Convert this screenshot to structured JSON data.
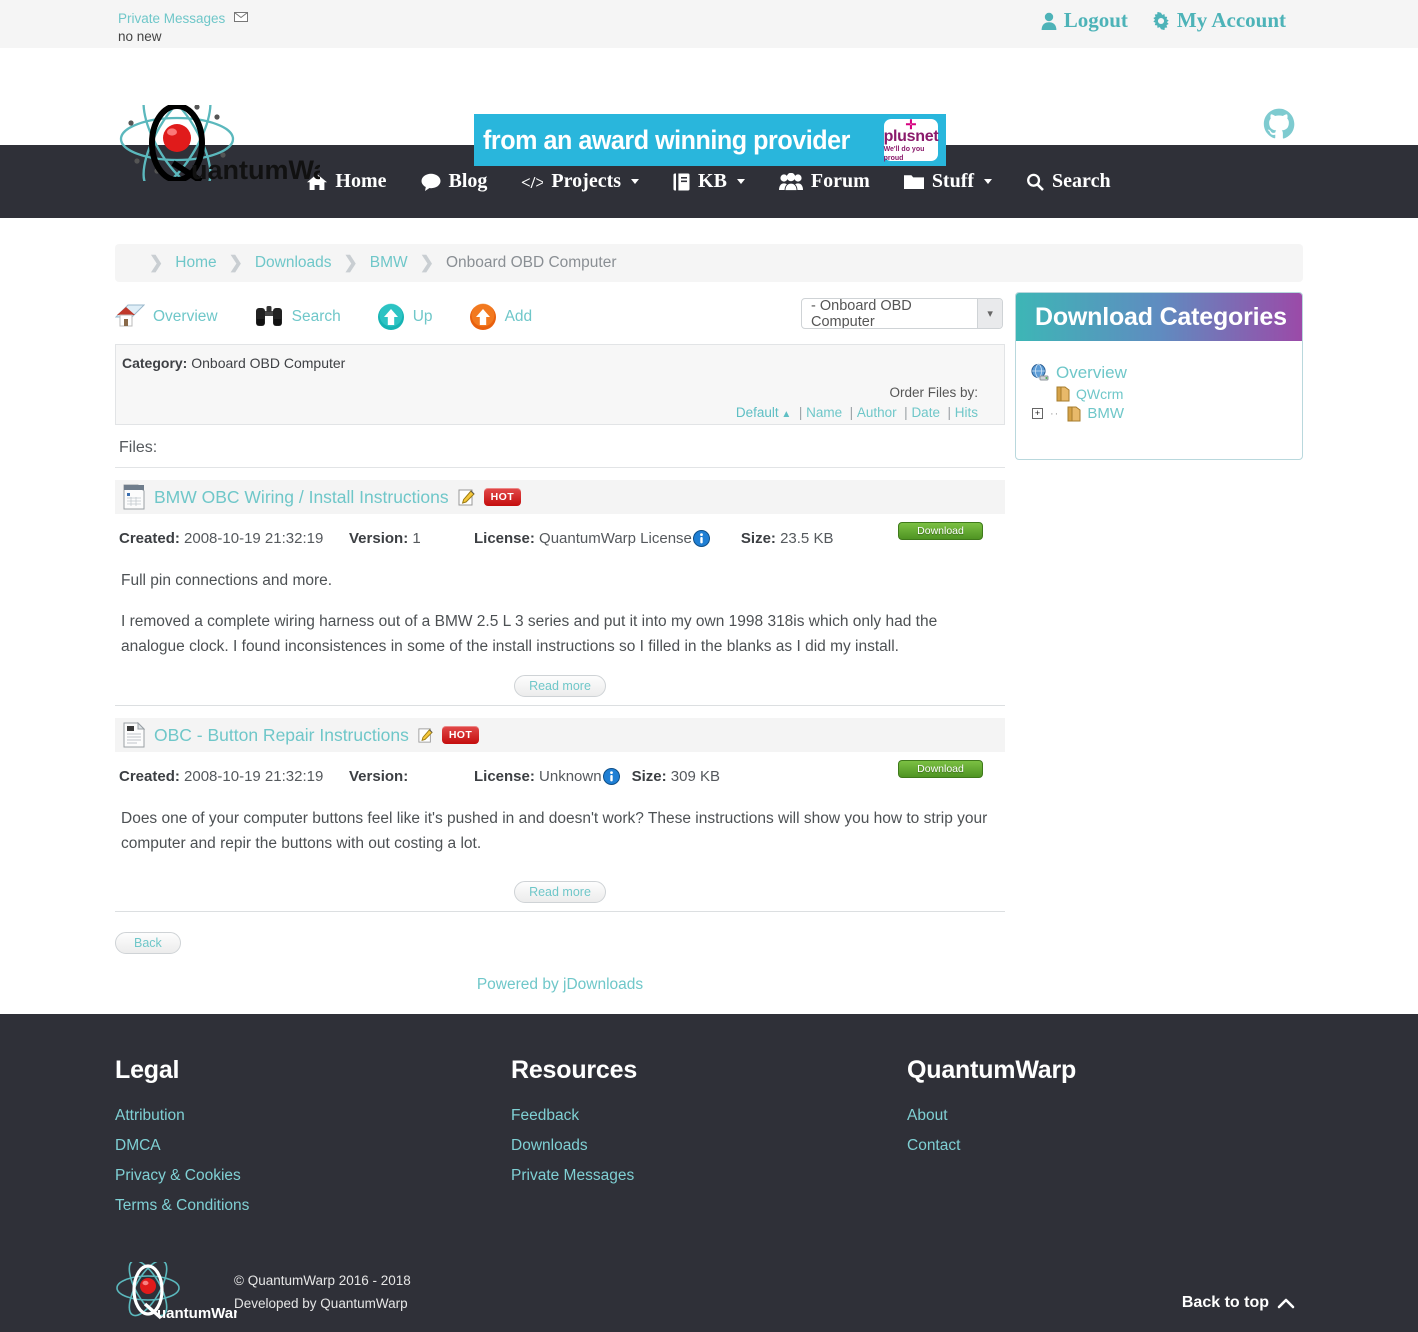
{
  "topbar": {
    "pm_link": "Private Messages",
    "pm_icon": "envelope-icon",
    "pm_status": "no new",
    "logout": "Logout",
    "my_account": "My Account"
  },
  "header": {
    "logo_text": "uantumWarp",
    "logo_initial": "Q",
    "banner_text": "from an award winning provider",
    "banner_brand": "plusnet",
    "banner_tagline": "We'll do you proud",
    "github_icon": "github-icon"
  },
  "nav": {
    "items": [
      {
        "label": "Home",
        "icon": "home-icon",
        "caret": false
      },
      {
        "label": "Blog",
        "icon": "comment-icon",
        "caret": false
      },
      {
        "label": "Projects",
        "icon": "code-icon",
        "caret": true
      },
      {
        "label": "KB",
        "icon": "book-icon",
        "caret": true
      },
      {
        "label": "Forum",
        "icon": "users-icon",
        "caret": false
      },
      {
        "label": "Stuff",
        "icon": "folder-icon",
        "caret": true
      },
      {
        "label": "Search",
        "icon": "search-icon",
        "caret": false
      }
    ]
  },
  "breadcrumb": {
    "items": [
      "Home",
      "Downloads",
      "BMW"
    ],
    "current": "Onboard OBD Computer"
  },
  "toolbar": {
    "overview": "Overview",
    "search": "Search",
    "up": "Up",
    "add": "Add",
    "category_select_value": "- Onboard OBD Computer"
  },
  "category": {
    "heading_label": "Category:",
    "heading_value": "Onboard OBD Computer",
    "order_label": "Order Files by:",
    "order_default": "Default",
    "order_options": [
      "Name",
      "Author",
      "Date",
      "Hits"
    ],
    "files_label": "Files:"
  },
  "files": [
    {
      "icon": "document-icon",
      "title": "BMW OBC Wiring / Install Instructions",
      "edit_icon": "edit-pencil-icon",
      "badge": "HOT",
      "created_label": "Created:",
      "created": "2008-10-19 21:32:19",
      "version_label": "Version:",
      "version": "1",
      "license_label": "License:",
      "license": "QuantumWarp License",
      "info_icon": "info-icon",
      "size_label": "Size:",
      "size": "23.5 KB",
      "download_label": "Download",
      "description_1": "Full pin connections and more.",
      "description_2": "I removed a complete wiring harness out of a BMW 2.5 L 3 series and put it into my own 1998 318is which only had the analogue clock. I found inconsistences in some of the install instructions so I filled in the blanks as I did my install.",
      "read_more": "Read more"
    },
    {
      "icon": "document-icon",
      "title": "OBC - Button Repair Instructions",
      "edit_icon": "edit-pencil-icon",
      "badge": "HOT",
      "created_label": "Created:",
      "created": "2008-10-19 21:32:19",
      "version_label": "Version:",
      "version": "",
      "license_label": "License:",
      "license": "Unknown",
      "info_icon": "info-icon",
      "size_label": "Size:",
      "size": "309 KB",
      "download_label": "Download",
      "description_1": "Does one of your computer buttons feel like it's pushed in and doesn't work? These instructions will show you how to strip your computer and repir the buttons with out costing a lot.",
      "description_2": "",
      "read_more": "Read more"
    }
  ],
  "page_footer": {
    "back": "Back",
    "powered_by": "Powered by jDownloads"
  },
  "sidebar": {
    "title": "Download Categories",
    "tree": [
      {
        "label": "Overview",
        "icon": "globe-icon",
        "level": 0,
        "expander": false
      },
      {
        "label": "QWcrm",
        "icon": "folder-icon",
        "level": 1,
        "expander": false
      },
      {
        "label": "BMW",
        "icon": "folder-icon",
        "level": 1,
        "expander": true
      }
    ]
  },
  "footer": {
    "columns": [
      {
        "heading": "Legal",
        "links": [
          "Attribution",
          "DMCA",
          "Privacy & Cookies",
          "Terms & Conditions"
        ]
      },
      {
        "heading": "Resources",
        "links": [
          "Feedback",
          "Downloads",
          "Private Messages"
        ]
      },
      {
        "heading": "QuantumWarp",
        "links": [
          "About",
          "Contact"
        ]
      }
    ],
    "copyright": "© QuantumWarp 2016 - 2018",
    "developed": "Developed by QuantumWarp",
    "back_to_top": "Back to top",
    "logo_initial": "Q",
    "logo_text": "uantumWarp"
  },
  "colors": {
    "teal": "#6fc7c9",
    "nav_dark": "#2f3038",
    "banner_blue": "#29b6dc",
    "hot_red": "#c40d0d",
    "download_green": "#4f9423"
  }
}
